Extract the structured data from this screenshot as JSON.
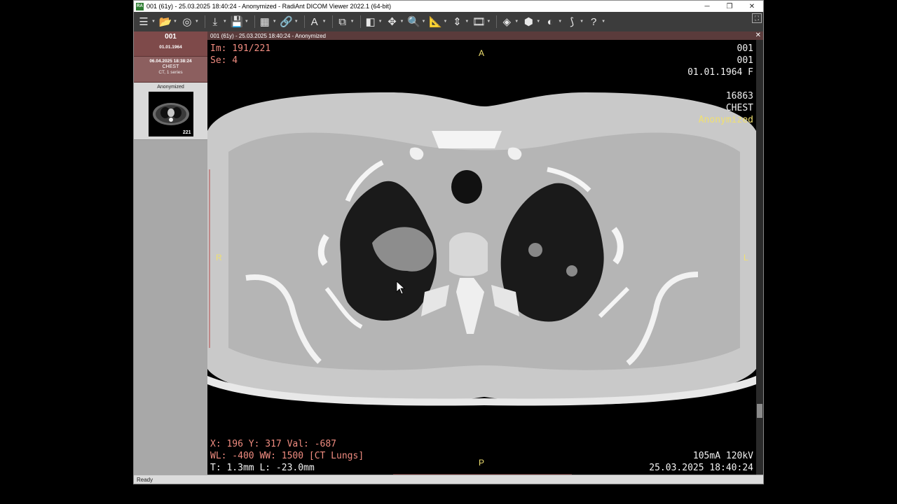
{
  "window": {
    "title": "001 (61y) - 25.03.2025 18:40:24 - Anonymized - RadiAnt DICOM Viewer 2022.1 (64-bit)",
    "app_icon_text": "RA",
    "minimize": "─",
    "restore": "❐",
    "close": "✕"
  },
  "toolbar": {
    "tools": [
      {
        "name": "database-icon",
        "glyph": "☰"
      },
      {
        "name": "open-folder-icon",
        "glyph": "📂"
      },
      {
        "name": "cd-icon",
        "glyph": "◎"
      },
      {
        "name": "download-icon",
        "glyph": "⤓"
      },
      {
        "name": "save-icon",
        "glyph": "💾"
      },
      {
        "name": "layout-icon",
        "glyph": "▦"
      },
      {
        "name": "link-icon",
        "glyph": "🔗"
      },
      {
        "name": "annotation-icon",
        "glyph": "A"
      },
      {
        "name": "copy-icon",
        "glyph": "⧉"
      },
      {
        "name": "window-level-icon",
        "glyph": "◧"
      },
      {
        "name": "pan-icon",
        "glyph": "✥"
      },
      {
        "name": "zoom-icon",
        "glyph": "🔍"
      },
      {
        "name": "measure-icon",
        "glyph": "📐"
      },
      {
        "name": "scroll-icon",
        "glyph": "⇕"
      },
      {
        "name": "cine-icon",
        "glyph": "🎞"
      },
      {
        "name": "mpr-icon",
        "glyph": "◈"
      },
      {
        "name": "3d-icon",
        "glyph": "⬢"
      },
      {
        "name": "fusion-icon",
        "glyph": "◐"
      },
      {
        "name": "curve-icon",
        "glyph": "⟆"
      },
      {
        "name": "help-icon",
        "glyph": "?"
      }
    ],
    "fullscreen": "⛶"
  },
  "sidebar": {
    "patient_id": "001",
    "patient_dob": "01.01.1964",
    "study_datetime": "06.04.2025 18:38:24",
    "study_body_part": "CHEST",
    "study_modality": "CT, 1 series",
    "series_label": "Anonymized",
    "series_count": "221"
  },
  "viewer": {
    "header": "001 (61y) - 25.03.2025 18:40:24 - Anonymized",
    "close": "✕",
    "overlay": {
      "image_number": "Im: 191/221",
      "series_number": "Se: 4",
      "top_right_1": "001",
      "top_right_2": "001",
      "top_right_3": "01.01.1964 F",
      "top_right_4": "16863",
      "top_right_5": "CHEST",
      "top_right_6": "Anonymized",
      "pixel_info": "X: 196 Y: 317 Val: -687",
      "window": "WL: -400 WW: 1500 [CT Lungs]",
      "thickness": "T: 1.3mm L: -23.0mm",
      "exposure": "105mA 120kV",
      "acq_datetime": "25.03.2025 18:40:24"
    },
    "orientation": {
      "top": "A",
      "bottom": "P",
      "left": "R",
      "right": "L"
    }
  },
  "status": {
    "text": "Ready"
  }
}
